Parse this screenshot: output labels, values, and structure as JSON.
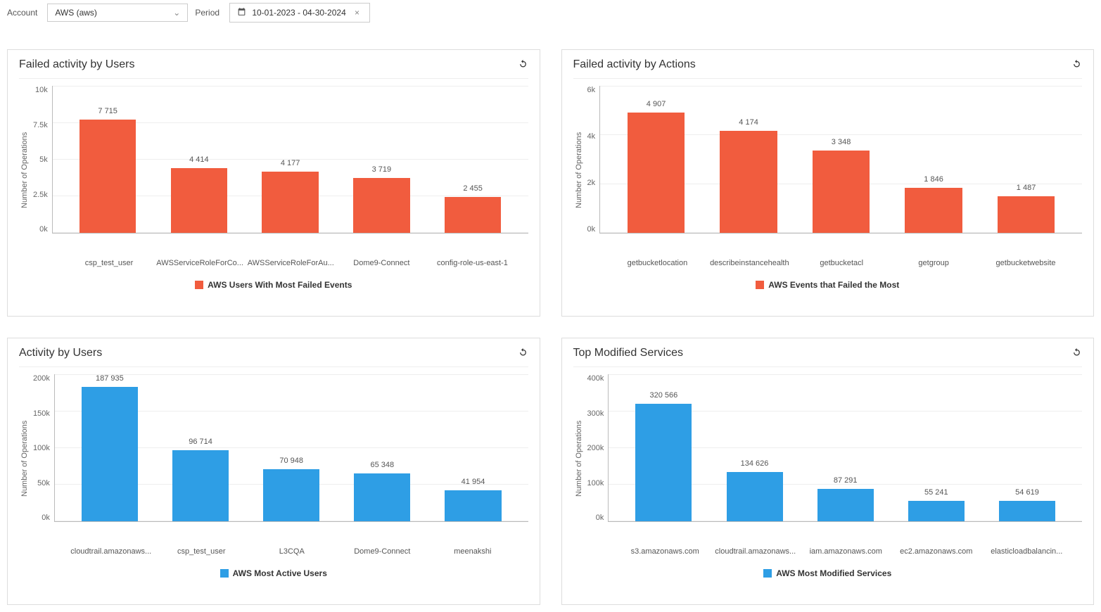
{
  "filters": {
    "account_label": "Account",
    "account_value": "AWS (aws)",
    "period_label": "Period",
    "period_value": "10-01-2023 - 04-30-2024"
  },
  "panels": {
    "failed_users": {
      "title": "Failed activity by Users",
      "ylabel": "Number of Operations",
      "legend": "AWS Users With Most Failed Events"
    },
    "failed_actions": {
      "title": "Failed activity by Actions",
      "ylabel": "Number of Operations",
      "legend": "AWS Events that Failed the Most"
    },
    "activity_users": {
      "title": "Activity by Users",
      "ylabel": "Number of Operations",
      "legend": "AWS Most Active Users"
    },
    "top_services": {
      "title": "Top Modified Services",
      "ylabel": "Number of Operations",
      "legend": "AWS Most Modified Services"
    }
  },
  "chart_data": [
    {
      "id": "failed_users",
      "type": "bar",
      "color": "#f15c3e",
      "ylabel": "Number of Operations",
      "ylim": [
        0,
        10000
      ],
      "yticks": [
        "10k",
        "7.5k",
        "5k",
        "2.5k",
        "0k"
      ],
      "categories": [
        "csp_test_user",
        "AWSServiceRoleForCo...",
        "AWSServiceRoleForAu...",
        "Dome9-Connect",
        "config-role-us-east-1"
      ],
      "values": [
        7715,
        4414,
        4177,
        3719,
        2455
      ],
      "value_labels": [
        "7 715",
        "4 414",
        "4 177",
        "3 719",
        "2 455"
      ],
      "legend": "AWS Users With Most Failed Events"
    },
    {
      "id": "failed_actions",
      "type": "bar",
      "color": "#f15c3e",
      "ylabel": "Number of Operations",
      "ylim": [
        0,
        6000
      ],
      "yticks": [
        "6k",
        "4k",
        "2k",
        "0k"
      ],
      "categories": [
        "getbucketlocation",
        "describeinstancehealth",
        "getbucketacl",
        "getgroup",
        "getbucketwebsite"
      ],
      "values": [
        4907,
        4174,
        3348,
        1846,
        1487
      ],
      "value_labels": [
        "4 907",
        "4 174",
        "3 348",
        "1 846",
        "1 487"
      ],
      "legend": "AWS Events that Failed the Most"
    },
    {
      "id": "activity_users",
      "type": "bar",
      "color": "#2e9ee5",
      "ylabel": "Number of Operations",
      "ylim": [
        0,
        200000
      ],
      "yticks": [
        "200k",
        "150k",
        "100k",
        "50k",
        "0k"
      ],
      "categories": [
        "cloudtrail.amazonaws...",
        "csp_test_user",
        "L3CQA",
        "Dome9-Connect",
        "meenakshi"
      ],
      "values": [
        187935,
        96714,
        70948,
        65348,
        41954
      ],
      "value_labels": [
        "187 935",
        "96 714",
        "70 948",
        "65 348",
        "41 954"
      ],
      "legend": "AWS Most Active Users"
    },
    {
      "id": "top_services",
      "type": "bar",
      "color": "#2e9ee5",
      "ylabel": "Number of Operations",
      "ylim": [
        0,
        400000
      ],
      "yticks": [
        "400k",
        "300k",
        "200k",
        "100k",
        "0k"
      ],
      "categories": [
        "s3.amazonaws.com",
        "cloudtrail.amazonaws...",
        "iam.amazonaws.com",
        "ec2.amazonaws.com",
        "elasticloadbalancin..."
      ],
      "values": [
        320566,
        134626,
        87291,
        55241,
        54619
      ],
      "value_labels": [
        "320 566",
        "134 626",
        "87 291",
        "55 241",
        "54 619"
      ],
      "legend": "AWS Most Modified Services"
    }
  ]
}
